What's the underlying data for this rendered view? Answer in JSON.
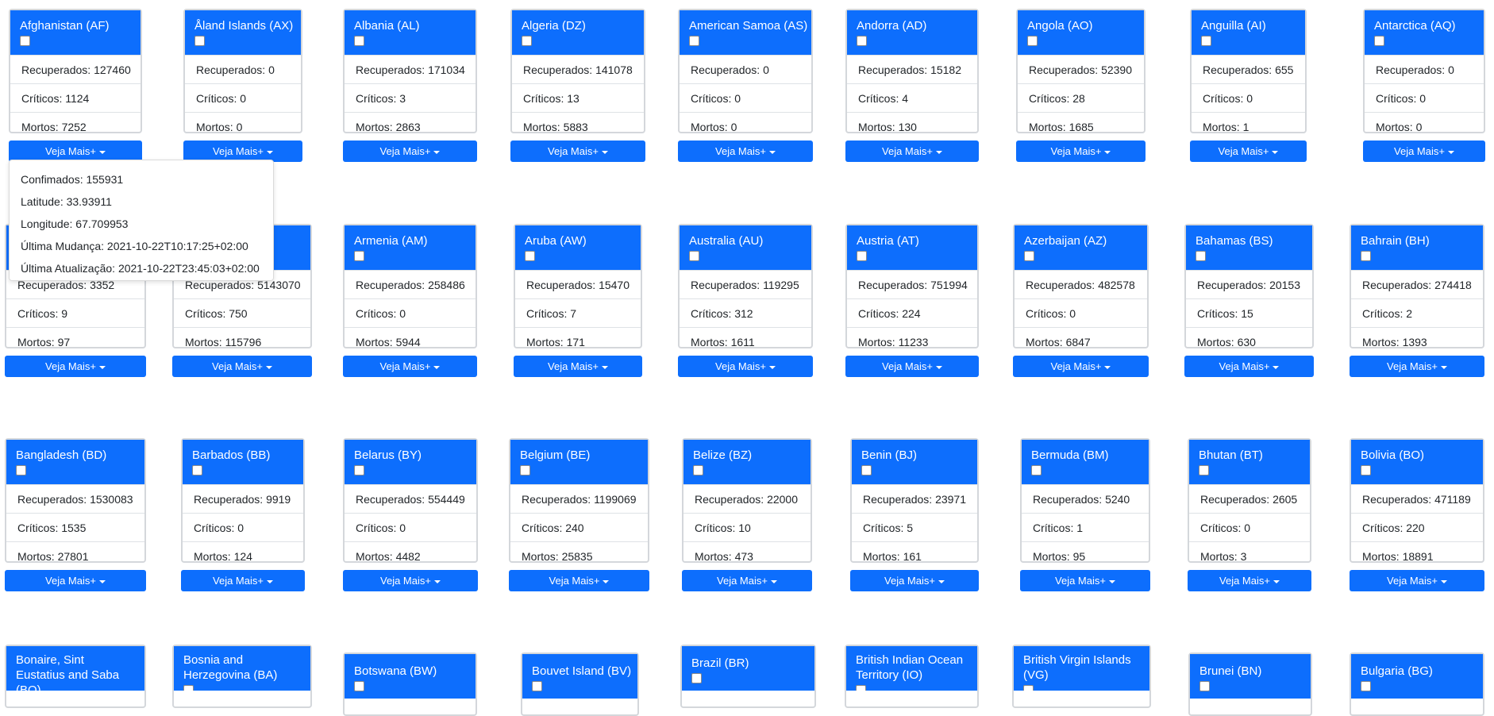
{
  "labels": {
    "recovered": "Recuperados: ",
    "critical": "Críticos: ",
    "deaths": "Mortos: ",
    "more_button": "Veja Mais+"
  },
  "cards": [
    {
      "name": "Afghanistan (AF)",
      "recovered": "127460",
      "critical": "1124",
      "deaths": "7252"
    },
    {
      "name": "Åland Islands (AX)",
      "recovered": "0",
      "critical": "0",
      "deaths": "0"
    },
    {
      "name": "Albania (AL)",
      "recovered": "171034",
      "critical": "3",
      "deaths": "2863"
    },
    {
      "name": "Algeria (DZ)",
      "recovered": "141078",
      "critical": "13",
      "deaths": "5883"
    },
    {
      "name": "American Samoa (AS)",
      "recovered": "0",
      "critical": "0",
      "deaths": "0"
    },
    {
      "name": "Andorra (AD)",
      "recovered": "15182",
      "critical": "4",
      "deaths": "130"
    },
    {
      "name": "Angola (AO)",
      "recovered": "52390",
      "critical": "28",
      "deaths": "1685"
    },
    {
      "name": "Anguilla (AI)",
      "recovered": "655",
      "critical": "0",
      "deaths": "1"
    },
    {
      "name": "Antarctica (AQ)",
      "recovered": "0",
      "critical": "0",
      "deaths": "0"
    },
    {
      "name": "",
      "recovered": "3352",
      "critical": "9",
      "deaths": "97"
    },
    {
      "name": "",
      "recovered": "5143070",
      "critical": "750",
      "deaths": "115796"
    },
    {
      "name": "Armenia (AM)",
      "recovered": "258486",
      "critical": "0",
      "deaths": "5944"
    },
    {
      "name": "Aruba (AW)",
      "recovered": "15470",
      "critical": "7",
      "deaths": "171"
    },
    {
      "name": "Australia (AU)",
      "recovered": "119295",
      "critical": "312",
      "deaths": "1611"
    },
    {
      "name": "Austria (AT)",
      "recovered": "751994",
      "critical": "224",
      "deaths": "11233"
    },
    {
      "name": "Azerbaijan (AZ)",
      "recovered": "482578",
      "critical": "0",
      "deaths": "6847"
    },
    {
      "name": "Bahamas (BS)",
      "recovered": "20153",
      "critical": "15",
      "deaths": "630"
    },
    {
      "name": "Bahrain (BH)",
      "recovered": "274418",
      "critical": "2",
      "deaths": "1393"
    },
    {
      "name": "Bangladesh (BD)",
      "recovered": "1530083",
      "critical": "1535",
      "deaths": "27801"
    },
    {
      "name": "Barbados (BB)",
      "recovered": "9919",
      "critical": "0",
      "deaths": "124"
    },
    {
      "name": "Belarus (BY)",
      "recovered": "554449",
      "critical": "0",
      "deaths": "4482"
    },
    {
      "name": "Belgium (BE)",
      "recovered": "1199069",
      "critical": "240",
      "deaths": "25835"
    },
    {
      "name": "Belize (BZ)",
      "recovered": "22000",
      "critical": "10",
      "deaths": "473"
    },
    {
      "name": "Benin (BJ)",
      "recovered": "23971",
      "critical": "5",
      "deaths": "161"
    },
    {
      "name": "Bermuda (BM)",
      "recovered": "5240",
      "critical": "1",
      "deaths": "95"
    },
    {
      "name": "Bhutan (BT)",
      "recovered": "2605",
      "critical": "0",
      "deaths": "3"
    },
    {
      "name": "Bolivia (BO)",
      "recovered": "471189",
      "critical": "220",
      "deaths": "18891"
    },
    {
      "name": "Bonaire, Sint Eustatius and Saba (BQ)"
    },
    {
      "name": "Bosnia and Herzegovina (BA)"
    },
    {
      "name": "Botswana (BW)"
    },
    {
      "name": "Bouvet Island (BV)"
    },
    {
      "name": "Brazil (BR)"
    },
    {
      "name": "British Indian Ocean Territory (IO)"
    },
    {
      "name": "British Virgin Islands (VG)"
    },
    {
      "name": "Brunei (BN)"
    },
    {
      "name": "Bulgaria (BG)"
    }
  ],
  "dropdown": {
    "items": [
      "Confimados: 155931",
      "Latitude: 33.93911",
      "Longitude: 67.709953",
      "Última Mudança: 2021-10-22T10:17:25+02:00",
      "Última Atualização: 2021-10-22T23:45:03+02:00"
    ]
  },
  "colors": {
    "primary": "#0d6efd",
    "border": "#d4d7db"
  }
}
